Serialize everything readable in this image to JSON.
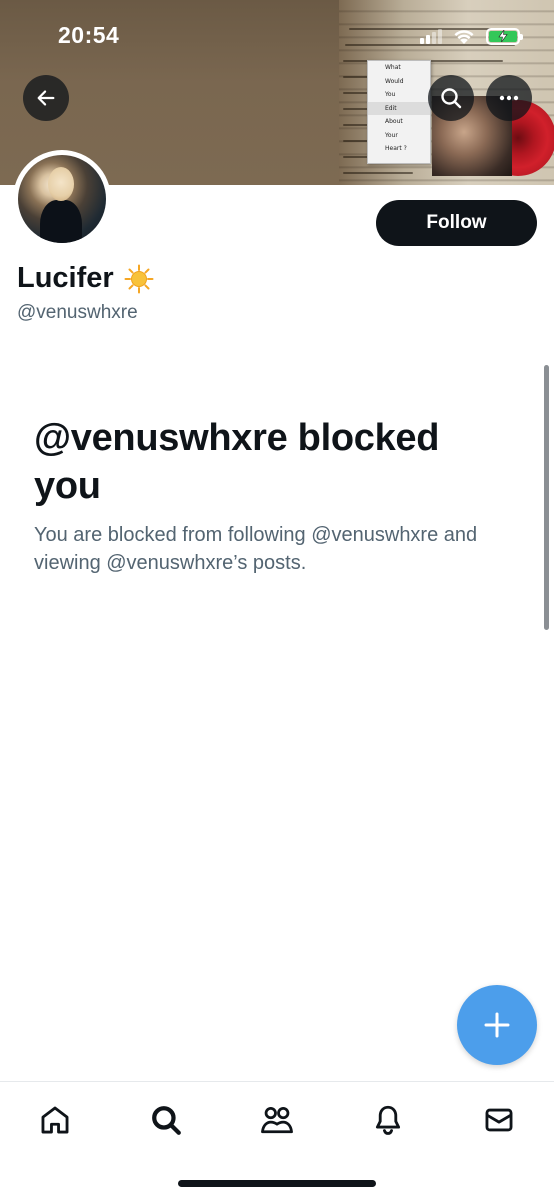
{
  "status_bar": {
    "time": "20:54"
  },
  "banner": {
    "menu_items": [
      "What",
      "Would",
      "You",
      "Edit",
      "About",
      "Your",
      "Heart ?"
    ],
    "selected_menu_item": "Edit"
  },
  "toolbar": {
    "back_icon": "arrow-left-icon",
    "search_icon": "search-icon",
    "more_icon": "more-horizontal-icon"
  },
  "profile": {
    "display_name": "Lucifer",
    "name_emoji_icon": "sun-icon",
    "handle": "@venuswhxre",
    "follow_label": "Follow"
  },
  "blocked": {
    "title": "@venuswhxre blocked you",
    "description": "You are blocked from following @venuswhxre and viewing @venuswhxre’s posts."
  },
  "fab": {
    "icon": "plus-icon"
  },
  "bottom_nav": {
    "items": [
      {
        "name": "home",
        "icon": "home-icon"
      },
      {
        "name": "search",
        "icon": "search-icon"
      },
      {
        "name": "communities",
        "icon": "people-icon"
      },
      {
        "name": "notifications",
        "icon": "bell-icon"
      },
      {
        "name": "messages",
        "icon": "mail-icon"
      }
    ]
  },
  "colors": {
    "accent": "#4c9eeb",
    "text_primary": "#0f1419",
    "text_secondary": "#536471",
    "battery_green": "#34c759"
  }
}
